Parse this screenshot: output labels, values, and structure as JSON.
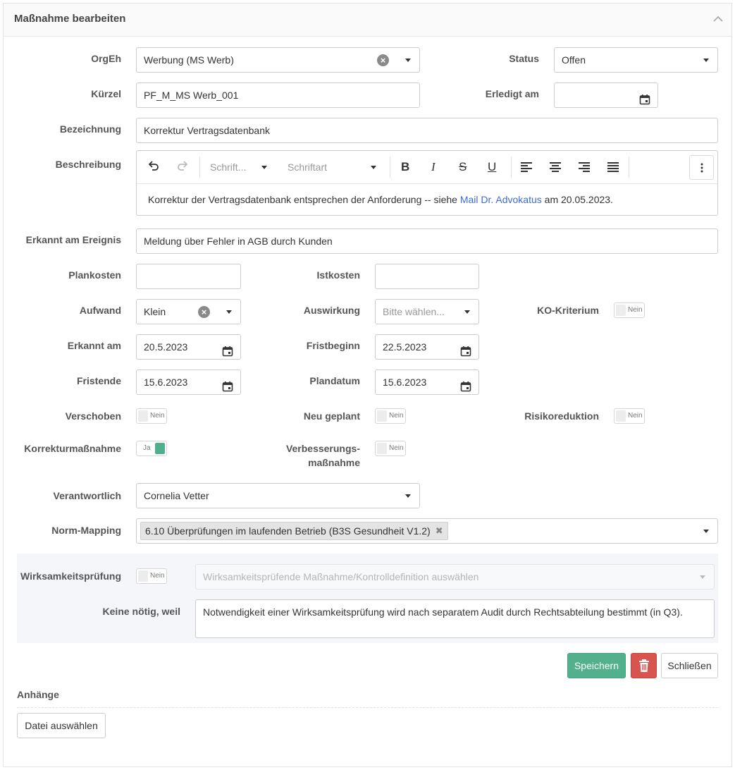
{
  "panel": {
    "title": "Maßnahme bearbeiten"
  },
  "fields": {
    "orgeh": {
      "label": "OrgEh",
      "value": "Werbung (MS Werb)"
    },
    "status": {
      "label": "Status",
      "value": "Offen"
    },
    "kuerzel": {
      "label": "Kürzel",
      "value": "PF_M_MS Werb_001"
    },
    "erledigt_am": {
      "label": "Erledigt am",
      "value": ""
    },
    "bezeichnung": {
      "label": "Bezeichnung",
      "value": "Korrektur Vertragsdatenbank"
    },
    "beschreibung": {
      "label": "Beschreibung",
      "toolbar": {
        "font_size": "Schrift...",
        "font_family": "Schriftart"
      },
      "text_before": "Korrektur der Vertragsdatenbank entsprechen der Anforderung -- siehe ",
      "link_text": "Mail Dr. Advokatus",
      "text_after": " am 20.05.2023."
    },
    "erkannt_am_ereignis": {
      "label": "Erkannt am Ereignis",
      "value": "Meldung über Fehler in AGB durch Kunden"
    },
    "plankosten": {
      "label": "Plankosten",
      "value": ""
    },
    "istkosten": {
      "label": "Istkosten",
      "value": ""
    },
    "aufwand": {
      "label": "Aufwand",
      "value": "Klein"
    },
    "auswirkung": {
      "label": "Auswirkung",
      "placeholder": "Bitte wählen..."
    },
    "ko_kriterium": {
      "label": "KO-Kriterium",
      "value": "Nein"
    },
    "erkannt_am": {
      "label": "Erkannt am",
      "value": "20.5.2023"
    },
    "fristbeginn": {
      "label": "Fristbeginn",
      "value": "22.5.2023"
    },
    "fristende": {
      "label": "Fristende",
      "value": "15.6.2023"
    },
    "plandatum": {
      "label": "Plandatum",
      "value": "15.6.2023"
    },
    "verschoben": {
      "label": "Verschoben",
      "value": "Nein"
    },
    "neu_geplant": {
      "label": "Neu geplant",
      "value": "Nein"
    },
    "risikoreduktion": {
      "label": "Risikoreduktion",
      "value": "Nein"
    },
    "korrekturmassnahme": {
      "label": "Korrekturmaßnahme",
      "value": "Ja"
    },
    "verbesserungsmassnahme": {
      "label_line1": "Verbesserungs-",
      "label_line2": "maßnahme",
      "value": "Nein"
    },
    "verantwortlich": {
      "label": "Verantwortlich",
      "value": "Cornelia Vetter"
    },
    "norm_mapping": {
      "label": "Norm-Mapping",
      "tag": "6.10 Überprüfungen im laufenden Betrieb (B3S Gesundheit V1.2)"
    },
    "wirksamkeitspruefung": {
      "label": "Wirksamkeitsprüfung",
      "value": "Nein",
      "placeholder": "Wirksamkeitsprüfende Maßnahme/Kontrolldefinition auswählen"
    },
    "keine_noetig": {
      "label": "Keine nötig, weil",
      "value": "Notwendigkeit einer Wirksamkeitsprüfung wird nach separatem Audit durch Rechtsabteilung bestimmt (in Q3)."
    }
  },
  "actions": {
    "save": "Speichern",
    "close": "Schließen"
  },
  "attachments": {
    "title": "Anhänge",
    "choose_file": "Datei auswählen"
  },
  "colors": {
    "accent": "#52b08c",
    "danger": "#d9534f",
    "link": "#3e6bd6"
  }
}
